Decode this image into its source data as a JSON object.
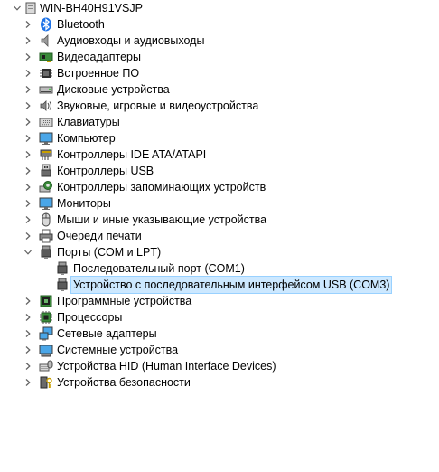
{
  "tree": {
    "root": {
      "label": "WIN-BH40H91VSJP",
      "icon": "computer-icon",
      "expanded": true
    },
    "categories": [
      {
        "label": "Bluetooth",
        "icon": "bluetooth-icon",
        "expanded": false
      },
      {
        "label": "Аудиовходы и аудиовыходы",
        "icon": "speaker-icon",
        "expanded": false
      },
      {
        "label": "Видеоадаптеры",
        "icon": "display-adapter-icon",
        "expanded": false
      },
      {
        "label": "Встроенное ПО",
        "icon": "firmware-icon",
        "expanded": false
      },
      {
        "label": "Дисковые устройства",
        "icon": "disk-drive-icon",
        "expanded": false
      },
      {
        "label": "Звуковые, игровые и видеоустройства",
        "icon": "sound-video-icon",
        "expanded": false
      },
      {
        "label": "Клавиатуры",
        "icon": "keyboard-icon",
        "expanded": false
      },
      {
        "label": "Компьютер",
        "icon": "monitor-icon",
        "expanded": false
      },
      {
        "label": "Контроллеры IDE ATA/ATAPI",
        "icon": "ide-controller-icon",
        "expanded": false
      },
      {
        "label": "Контроллеры USB",
        "icon": "usb-controller-icon",
        "expanded": false
      },
      {
        "label": "Контроллеры запоминающих устройств",
        "icon": "storage-controller-icon",
        "expanded": false
      },
      {
        "label": "Мониторы",
        "icon": "monitor-icon",
        "expanded": false
      },
      {
        "label": "Мыши и иные указывающие устройства",
        "icon": "mouse-icon",
        "expanded": false
      },
      {
        "label": "Очереди печати",
        "icon": "printer-icon",
        "expanded": false
      },
      {
        "label": "Порты (COM и LPT)",
        "icon": "port-icon",
        "expanded": true,
        "children": [
          {
            "label": "Последовательный порт (COM1)",
            "icon": "port-icon",
            "selected": false
          },
          {
            "label": "Устройство с последовательным интерфейсом USB (COM3)",
            "icon": "port-icon",
            "selected": true
          }
        ]
      },
      {
        "label": "Программные устройства",
        "icon": "software-device-icon",
        "expanded": false
      },
      {
        "label": "Процессоры",
        "icon": "processor-icon",
        "expanded": false
      },
      {
        "label": "Сетевые адаптеры",
        "icon": "network-adapter-icon",
        "expanded": false
      },
      {
        "label": "Системные устройства",
        "icon": "system-device-icon",
        "expanded": false
      },
      {
        "label": "Устройства HID (Human Interface Devices)",
        "icon": "hid-icon",
        "expanded": false
      },
      {
        "label": "Устройства безопасности",
        "icon": "security-device-icon",
        "expanded": false
      }
    ]
  },
  "colors": {
    "selection_bg": "#cce8ff",
    "selection_border": "#99d1ff",
    "bluetooth": "#1e73e8",
    "chevron": "#606060"
  }
}
